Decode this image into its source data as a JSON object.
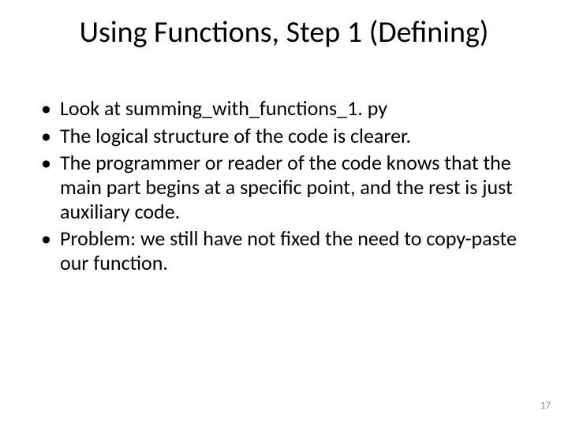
{
  "slide": {
    "title": "Using Functions, Step 1 (Defining)",
    "bullets": [
      "Look at summing_with_functions_1. py",
      "The logical structure of the code is clearer.",
      "The programmer or reader of the code knows that the main part begins at a specific point, and the rest is just auxiliary code.",
      "Problem: we still have not fixed the need to copy-paste our function."
    ],
    "page_number": "17"
  }
}
